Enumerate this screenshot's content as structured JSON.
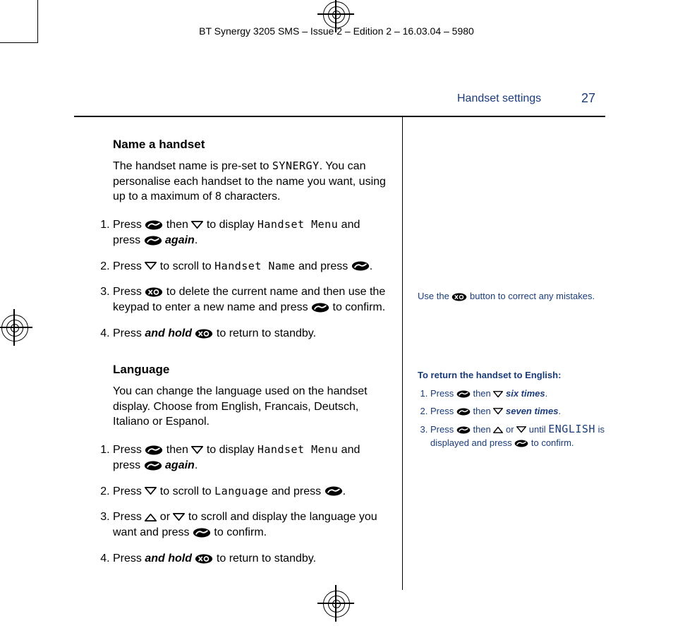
{
  "imposition_header": "BT Synergy 3205 SMS – Issue 2 – Edition 2 – 16.03.04 – 5980",
  "header": {
    "section": "Handset settings",
    "page": "27"
  },
  "icons": {
    "ok": "ok-phone-icon",
    "down": "down-arrow-icon",
    "up": "up-arrow-icon",
    "cancel": "cancel-phone-icon"
  },
  "name_section": {
    "title": "Name a handset",
    "intro_before": "The handset name is pre-set to ",
    "intro_mono": "SYNERGY",
    "intro_after": ". You can personalise each handset to the name you want, using up to a maximum of 8 characters.",
    "steps": {
      "s1a": "Press ",
      "s1b": " then ",
      "s1c": " to display ",
      "s1_mono": "Handset Menu",
      "s1d": " and press ",
      "s1e": "again",
      "s1f": ".",
      "s2a": "Press ",
      "s2b": " to scroll to ",
      "s2_mono": "Handset Name",
      "s2c": " and press ",
      "s2d": ".",
      "s3a": "Press ",
      "s3b": " to delete the current name and then use the keypad to enter a new name and press ",
      "s3c": " to confirm.",
      "s4a": "Press ",
      "s4_hold": "and hold",
      "s4b": " to return to standby."
    }
  },
  "lang_section": {
    "title": "Language",
    "intro": "You can change the language used on the handset display. Choose from English, Francais, Deutsch, Italiano or Espanol.",
    "steps": {
      "s1a": "Press ",
      "s1b": " then ",
      "s1c": " to display ",
      "s1_mono": "Handset Menu",
      "s1d": " and press ",
      "s1e": "again",
      "s1f": ".",
      "s2a": "Press ",
      "s2b": " to scroll to ",
      "s2_mono": "Language",
      "s2c": " and press ",
      "s2d": ".",
      "s3a": "Press ",
      "s3b": " or ",
      "s3c": " to scroll and display the language you want and press ",
      "s3d": " to confirm.",
      "s4a": "Press ",
      "s4_hold": "and hold",
      "s4b": " to return to standby."
    }
  },
  "sidebar": {
    "note_a": "Use the ",
    "note_b": " button to correct any mistakes.",
    "return_title": "To return the handset to English:",
    "s1a": "Press ",
    "s1b": " then ",
    "s1_six": "six times",
    "s1c": ".",
    "s2a": "Press ",
    "s2b": " then ",
    "s2_seven": "seven times",
    "s2c": ".",
    "s3a": "Press ",
    "s3b": " then ",
    "s3c": " or ",
    "s3d": " until ",
    "s3_mono": "ENGLISH",
    "s3e": " is displayed and press ",
    "s3f": " to confirm."
  }
}
